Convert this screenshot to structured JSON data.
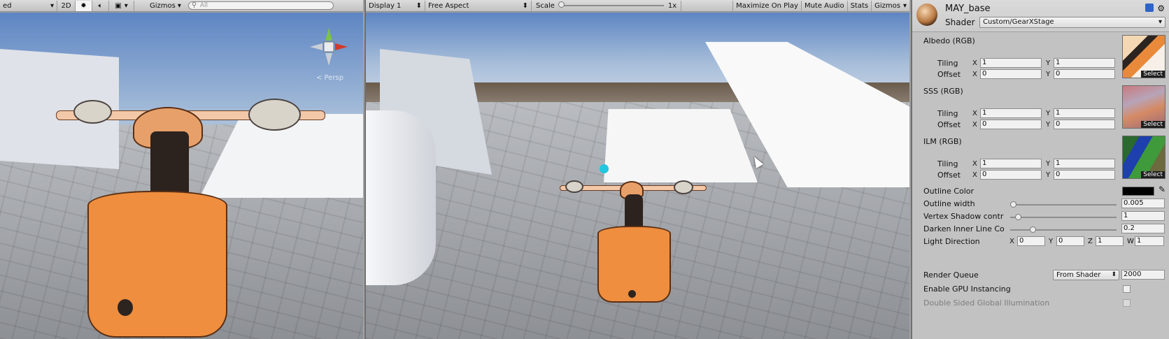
{
  "scene": {
    "toolbar": {
      "shading_mode_suffix": "ed",
      "mode_2d": "2D",
      "lighting_icon": "sun-icon",
      "audio_icon": "speaker-icon",
      "effects_icon": "image-icon",
      "gizmos_label": "Gizmos",
      "search_placeholder": "All"
    },
    "persp_label": "< Persp"
  },
  "game": {
    "toolbar": {
      "display": "Display 1",
      "aspect": "Free Aspect",
      "scale_label": "Scale",
      "scale_value": "1x",
      "maximize": "Maximize On Play",
      "mute": "Mute Audio",
      "stats": "Stats",
      "gizmos": "Gizmos"
    }
  },
  "inspector": {
    "material_name": "MAY_base",
    "shader_label": "Shader",
    "shader_value": "Custom/GearXStage",
    "textures": [
      {
        "label": "Albedo (RGB)",
        "tiling_x": "1",
        "tiling_y": "1",
        "offset_x": "0",
        "offset_y": "0",
        "select": "Select"
      },
      {
        "label": "SSS (RGB)",
        "tiling_x": "1",
        "tiling_y": "1",
        "offset_x": "0",
        "offset_y": "0",
        "select": "Select"
      },
      {
        "label": "ILM (RGB)",
        "tiling_x": "1",
        "tiling_y": "1",
        "offset_x": "0",
        "offset_y": "0",
        "select": "Select"
      }
    ],
    "tiling_label": "Tiling",
    "offset_label": "Offset",
    "x_label": "X",
    "y_label": "Y",
    "z_label": "Z",
    "w_label": "W",
    "outline_color_label": "Outline Color",
    "outline_color": "#000000",
    "outline_width_label": "Outline width",
    "outline_width_value": "0.005",
    "vertex_shadow_label": "Vertex Shadow contr",
    "vertex_shadow_value": "1",
    "darken_label": "Darken Inner Line Co",
    "darken_value": "0.2",
    "light_dir_label": "Light Direction",
    "light_dir": {
      "x": "0",
      "y": "0",
      "z": "1",
      "w": "1"
    },
    "render_queue_label": "Render Queue",
    "render_queue_mode": "From Shader",
    "render_queue_value": "2000",
    "gpu_instancing_label": "Enable GPU Instancing",
    "double_sided_label": "Double Sided Global Illumination"
  }
}
